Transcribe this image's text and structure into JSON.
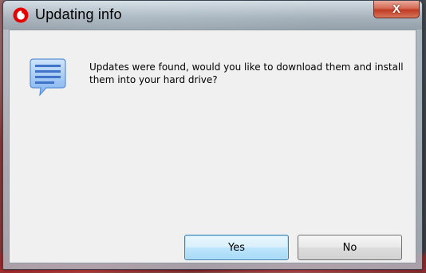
{
  "window": {
    "title": "Updating info",
    "close_label": "X",
    "icon": "vodafone-logo-icon"
  },
  "dialog": {
    "icon": "speech-bubble-icon",
    "message": "Updates were found, would you like to download them and install them into your hard drive?"
  },
  "buttons": {
    "yes_label": "Yes",
    "no_label": "No"
  },
  "colors": {
    "brand_red": "#e60000",
    "close_red": "#c03b22",
    "default_button_border": "#3c7fb1",
    "dialog_background": "#f0f0f0"
  }
}
